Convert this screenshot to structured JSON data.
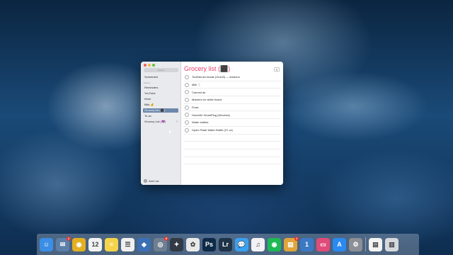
{
  "window": {
    "traffic_lights": {
      "close": "#ee5e56",
      "minimize": "#f1bb3d",
      "zoom": "#5fc33f"
    },
    "sidebar": {
      "search_placeholder": "Search",
      "scheduled_label": "Scheduled",
      "section_label": "iCloud",
      "lists": [
        {
          "label": "Reminders",
          "selected": false
        },
        {
          "label": "YouTube",
          "selected": false
        },
        {
          "label": "Work",
          "selected": false
        },
        {
          "label": "Bills 💰",
          "selected": false
        },
        {
          "label": "Grocery list (⬛)",
          "selected": true
        },
        {
          "label": "To do",
          "selected": false
        },
        {
          "label": "Grocery List (💜)",
          "selected": false
        }
      ],
      "shared_icon": "shared-people-icon",
      "add_list_label": "Add List"
    },
    "main": {
      "title": "Grocery list (⬛)",
      "title_color": "#e7416f",
      "add_button": "+",
      "items": [
        "Toothbrush heads (Oral-B) — Amazon",
        "Milk 🥛",
        "Canned air",
        "Markers for white board",
        "Floss",
        "HomeKit SmartPlug (iDevices)",
        "Water bottles",
        "Hydro Flask Water Bottle (21 oz)"
      ]
    }
  },
  "dock": {
    "apps": [
      {
        "name": "finder-icon",
        "glyph": "☺",
        "color": "#3a8ee6"
      },
      {
        "name": "mail-icon",
        "glyph": "✉",
        "color": "#5b7fa8",
        "badge": "1"
      },
      {
        "name": "chrome-icon",
        "glyph": "◉",
        "color": "#e4b022"
      },
      {
        "name": "calendar-icon",
        "glyph": "12",
        "color": "#f2f2f2"
      },
      {
        "name": "notes-icon",
        "glyph": "≡",
        "color": "#f5d34a"
      },
      {
        "name": "reminders-icon",
        "glyph": "☰",
        "color": "#f0f0f0"
      },
      {
        "name": "tweetbot-icon",
        "glyph": "◆",
        "color": "#3b6fb6"
      },
      {
        "name": "screenshot-icon",
        "glyph": "◎",
        "color": "#6f7f90",
        "badge": "8"
      },
      {
        "name": "final-cut-icon",
        "glyph": "✦",
        "color": "#333a45"
      },
      {
        "name": "photos-icon",
        "glyph": "✿",
        "color": "#e9e9e9"
      },
      {
        "name": "photoshop-icon",
        "glyph": "Ps",
        "color": "#0e2a47"
      },
      {
        "name": "lightroom-icon",
        "glyph": "Lr",
        "color": "#1f3348"
      },
      {
        "name": "messages-icon",
        "glyph": "💬",
        "color": "#3aa0f0"
      },
      {
        "name": "itunes-icon",
        "glyph": "♫",
        "color": "#f2f2f5"
      },
      {
        "name": "spotify-icon",
        "glyph": "◉",
        "color": "#1db954"
      },
      {
        "name": "keynote-icon",
        "glyph": "▤",
        "color": "#e0a53a",
        "badge": "1"
      },
      {
        "name": "1password-icon",
        "glyph": "1",
        "color": "#3c79c5"
      },
      {
        "name": "magnet-icon",
        "glyph": "▭",
        "color": "#e04b7a"
      },
      {
        "name": "app-store-icon",
        "glyph": "A",
        "color": "#2a8af1"
      },
      {
        "name": "system-preferences-icon",
        "glyph": "⚙",
        "color": "#8c8f96"
      },
      {
        "name": "documents-icon",
        "glyph": "▤",
        "color": "#f3f3f3"
      },
      {
        "name": "trash-icon",
        "glyph": "▥",
        "color": "#d5d8dc"
      }
    ]
  }
}
